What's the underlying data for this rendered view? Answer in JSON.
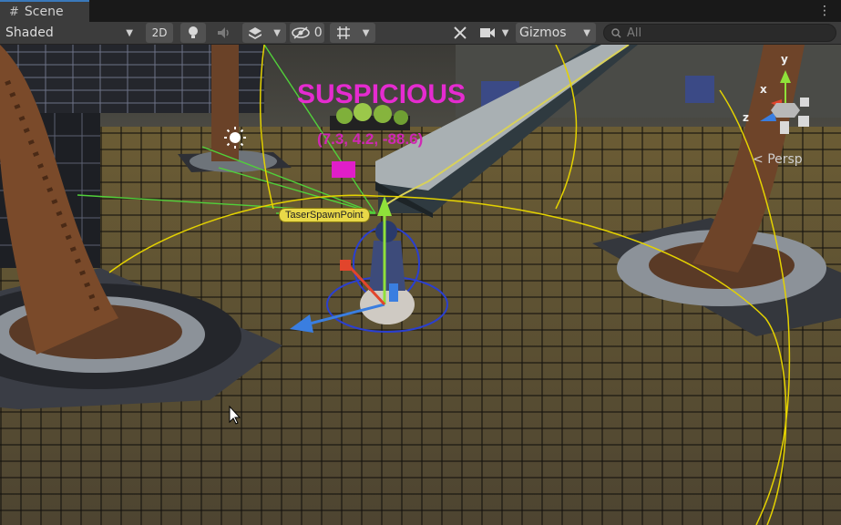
{
  "tab": {
    "label": "Scene"
  },
  "toolbar": {
    "shading_mode": "Shaded",
    "btn_2d": "2D",
    "hidden_count": "0",
    "gizmos_label": "Gizmos",
    "search_placeholder": "All"
  },
  "scene": {
    "status_text": "SUSPICIOUS",
    "coords_text": "(7.3, 4.2, -88.6)",
    "object_label": "TaserSpawnPoint",
    "projection": "Persp",
    "axis_x": "x",
    "axis_y": "y",
    "axis_z": "z"
  },
  "colors": {
    "accent": "#3a79bb",
    "suspicious": "#e52bd0",
    "gizmo_yellow": "#e8d848",
    "axis_green": "#8fe13a",
    "axis_red": "#e2452c",
    "axis_blue": "#3a7ee0"
  },
  "icons": [
    "hash-icon",
    "kebab-menu-icon",
    "lightbulb-icon",
    "audio-icon",
    "effects-icon",
    "visibility-icon",
    "grid-icon",
    "tools-icon",
    "camera-icon",
    "search-icon"
  ]
}
